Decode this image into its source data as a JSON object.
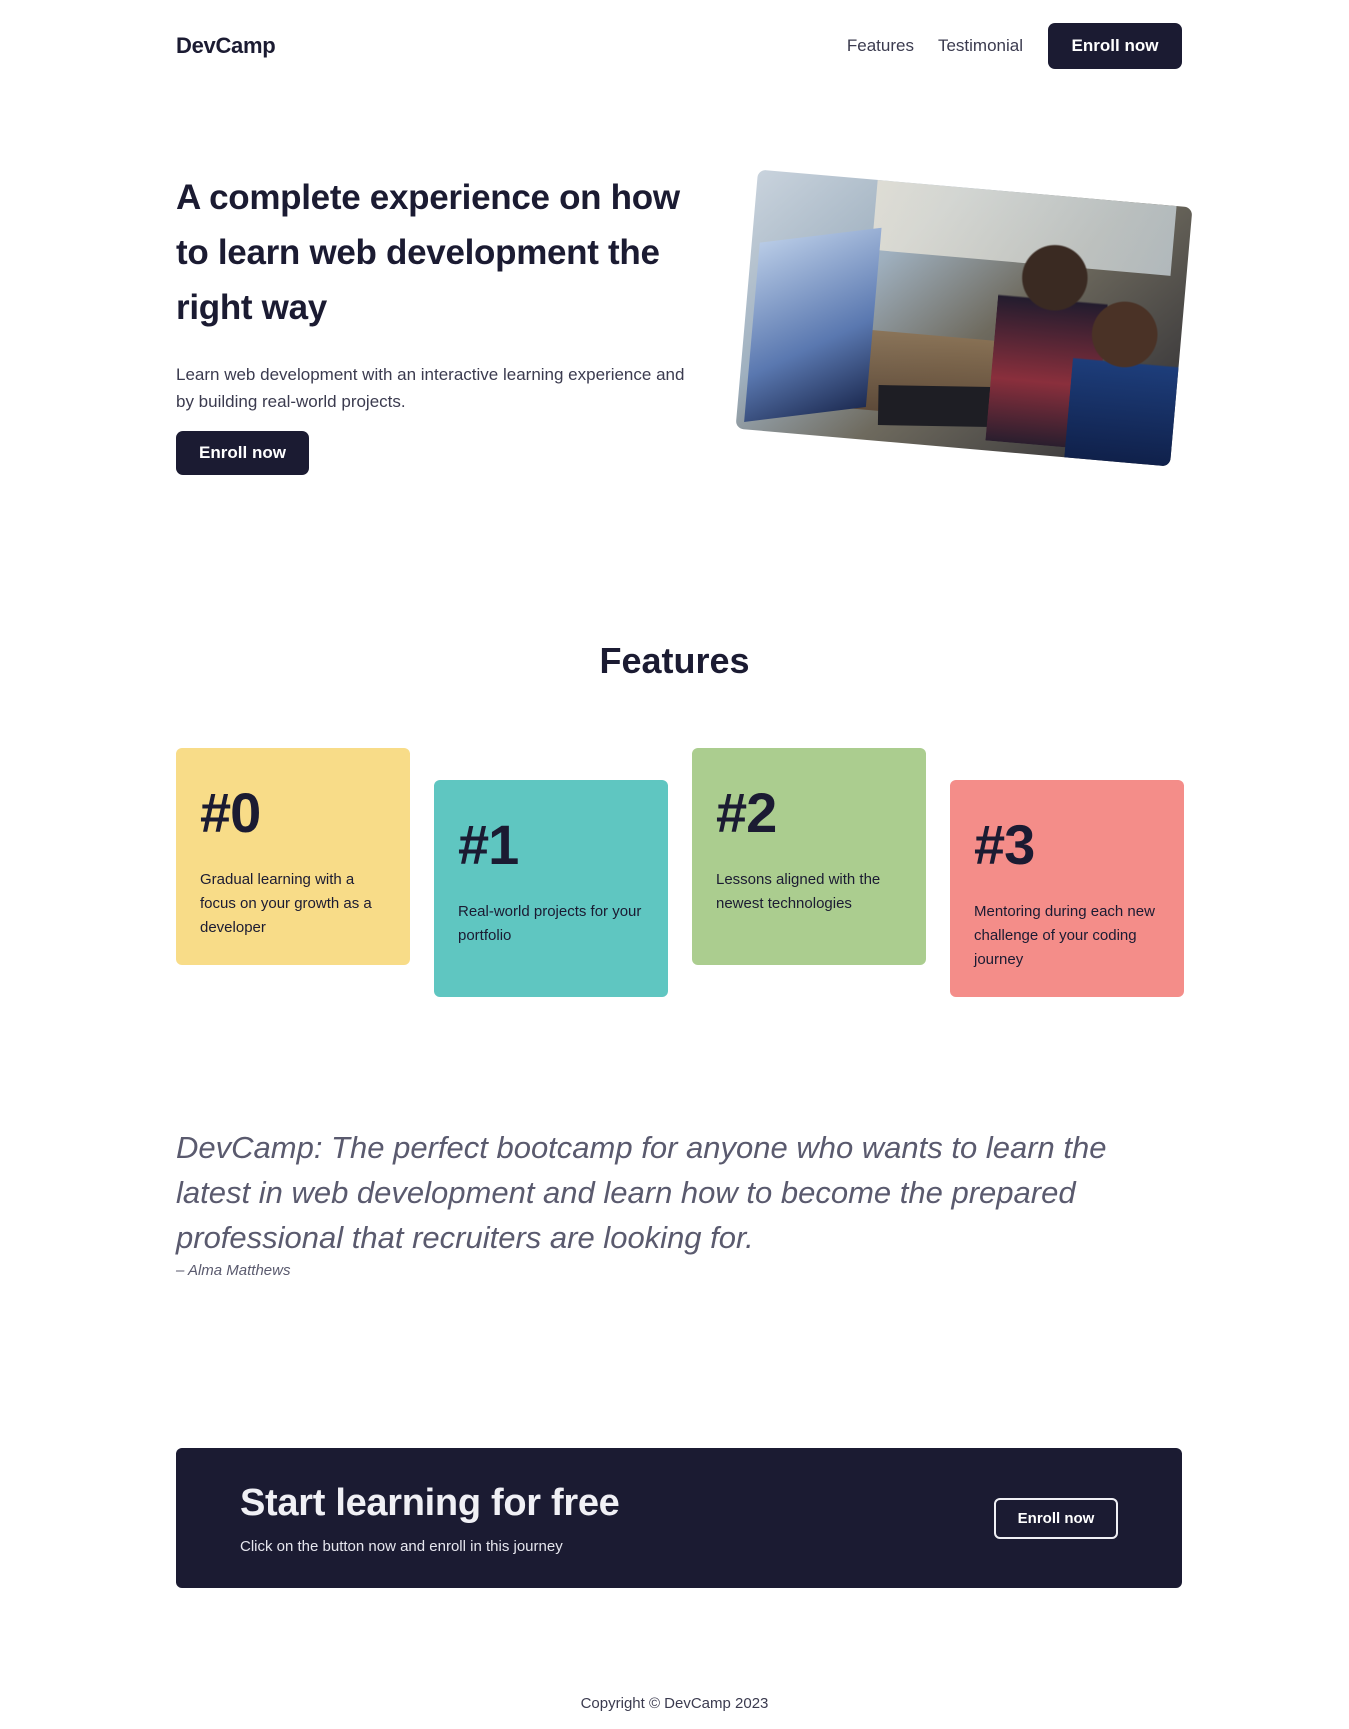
{
  "header": {
    "logo": "DevCamp",
    "nav": [
      {
        "label": "Features"
      },
      {
        "label": "Testimonial"
      }
    ],
    "cta_label": "Enroll now"
  },
  "hero": {
    "title": "A complete experience on how to learn web development the right way",
    "subtitle": "Learn web development with an interactive learning experience and by building real-world projects.",
    "button_label": "Enroll now",
    "image_icon": "students-at-computer-photo"
  },
  "features": {
    "title": "Features",
    "cards": [
      {
        "number": "#0",
        "text": "Gradual learning with a focus on your growth as a developer",
        "color": "#f8dc88"
      },
      {
        "number": "#1",
        "text": "Real-world projects for your portfolio",
        "color": "#5fc6c1"
      },
      {
        "number": "#2",
        "text": "Lessons aligned with the newest technologies",
        "color": "#abcd8f"
      },
      {
        "number": "#3",
        "text": "Mentoring during each new challenge of your coding journey",
        "color": "#f48d89"
      }
    ]
  },
  "testimonial": {
    "quote": "DevCamp: The perfect bootcamp for anyone who wants to learn the latest in web development and learn how to become the prepared professional that recruiters are looking for.",
    "author": "– Alma Matthews"
  },
  "cta": {
    "title": "Start learning for free",
    "subtitle": "Click on the button now and enroll in this journey",
    "button_label": "Enroll now"
  },
  "footer": {
    "copyright": "Copyright © DevCamp 2023"
  },
  "colors": {
    "primary": "#1b1b32",
    "text_muted": "#3b3b4f"
  }
}
